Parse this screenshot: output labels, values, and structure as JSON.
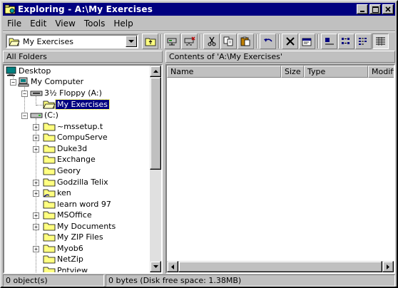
{
  "window": {
    "title": "Exploring - A:\\My Exercises"
  },
  "menu": [
    "File",
    "Edit",
    "View",
    "Tools",
    "Help"
  ],
  "toolbar": {
    "address_value": "My Exercises"
  },
  "left_pane": {
    "header": "All Folders",
    "tree": [
      {
        "label": "Desktop",
        "icon": "desktop-icon"
      },
      {
        "label": "My Computer",
        "icon": "computer-icon"
      },
      {
        "label": "3½ Floppy (A:)",
        "icon": "floppy-drive-icon"
      },
      {
        "label": "My Exercises",
        "icon": "folder-open-icon"
      },
      {
        "label": "(C:)",
        "icon": "hard-drive-icon"
      },
      {
        "label": "~mssetup.t",
        "icon": "folder-icon"
      },
      {
        "label": "CompuServe",
        "icon": "folder-icon"
      },
      {
        "label": "Duke3d",
        "icon": "folder-icon"
      },
      {
        "label": "Exchange",
        "icon": "folder-icon"
      },
      {
        "label": "Geory",
        "icon": "folder-icon"
      },
      {
        "label": "Godzilla Telix",
        "icon": "folder-icon"
      },
      {
        "label": "ken",
        "icon": "shared-folder-icon"
      },
      {
        "label": "learn word 97",
        "icon": "folder-icon"
      },
      {
        "label": "MSOffice",
        "icon": "folder-icon"
      },
      {
        "label": "My Documents",
        "icon": "folder-icon"
      },
      {
        "label": "My ZIP Files",
        "icon": "folder-icon"
      },
      {
        "label": "Myob6",
        "icon": "folder-icon"
      },
      {
        "label": "NetZip",
        "icon": "folder-icon"
      },
      {
        "label": "Pntview",
        "icon": "folder-icon"
      }
    ]
  },
  "right_pane": {
    "header": "Contents of 'A:\\My Exercises'",
    "columns": [
      "Name",
      "Size",
      "Type",
      "Modified"
    ]
  },
  "status": {
    "objects": "0 object(s)",
    "free_space": "0 bytes (Disk free space: 1.38MB)"
  },
  "colors": {
    "titlebar": "#000080",
    "face": "#c0c0c0",
    "folder": "#ffff80"
  }
}
